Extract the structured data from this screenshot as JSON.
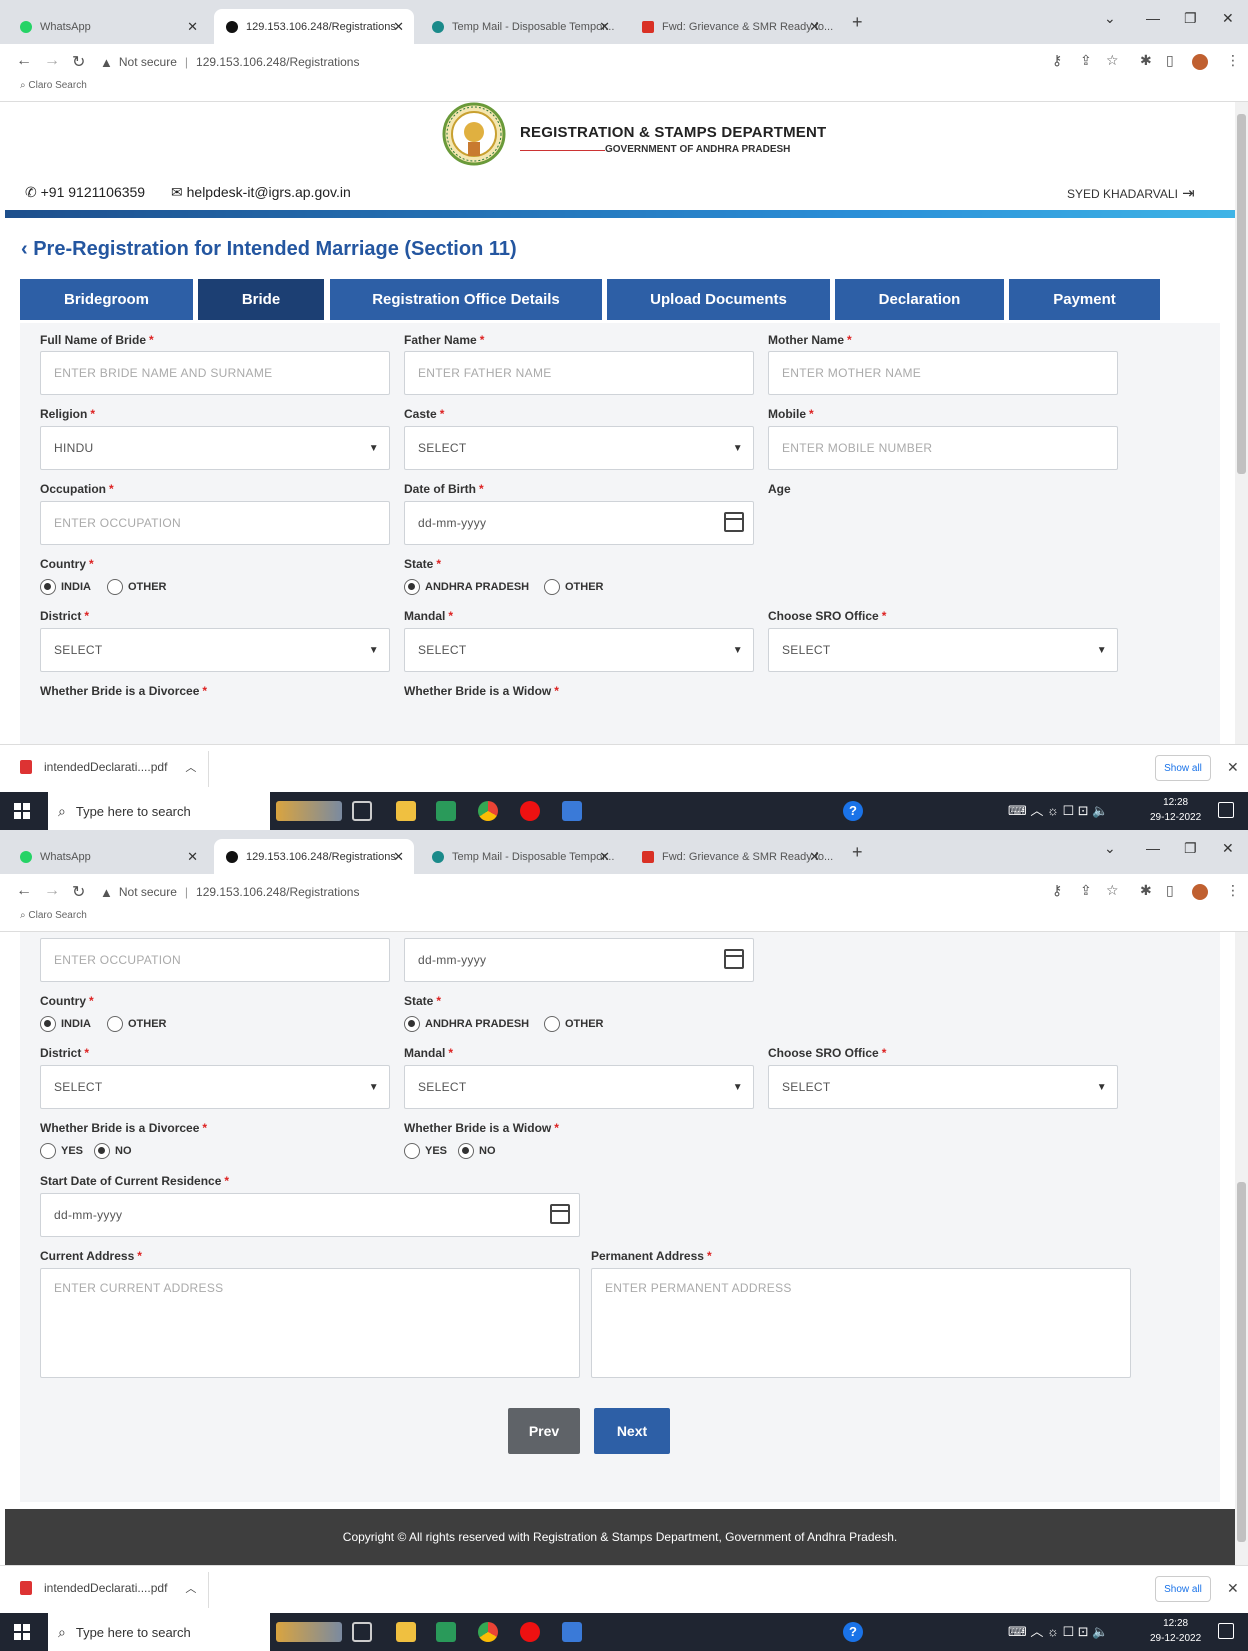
{
  "browser": {
    "tabs": [
      {
        "title": "WhatsApp",
        "active": false,
        "favicon_color": "#25d366"
      },
      {
        "title": "129.153.106.248/Registrations",
        "active": true,
        "favicon_color": "#111111"
      },
      {
        "title": "Temp Mail - Disposable Tempor...",
        "active": false,
        "favicon_color": "#1a8a8a"
      },
      {
        "title": "Fwd: Grievance & SMR Ready fo...",
        "active": false,
        "favicon_color": "#d93025"
      }
    ],
    "new_tab": "+",
    "not_secure": "Not secure",
    "url": "129.153.106.248/Registrations",
    "bookmark": "Claro Search"
  },
  "header": {
    "dept_title": "REGISTRATION & STAMPS DEPARTMENT",
    "dept_subtitle": "GOVERNMENT OF ANDHRA PRADESH",
    "phone": "+91 9121106359",
    "email": "helpdesk-it@igrs.ap.gov.in",
    "user": "SYED KHADARVALI"
  },
  "page_title": "Pre-Registration for Intended Marriage (Section 11)",
  "steps": [
    "Bridegroom",
    "Bride",
    "Registration Office Details",
    "Upload Documents",
    "Declaration",
    "Payment"
  ],
  "current_step": "Bride",
  "form": {
    "full_name": {
      "label": "Full Name of Bride",
      "placeholder": "ENTER BRIDE NAME AND SURNAME"
    },
    "father_name": {
      "label": "Father Name",
      "placeholder": "ENTER FATHER NAME"
    },
    "mother_name": {
      "label": "Mother Name",
      "placeholder": "ENTER MOTHER NAME"
    },
    "religion": {
      "label": "Religion",
      "value": "HINDU"
    },
    "caste": {
      "label": "Caste",
      "value": "SELECT"
    },
    "mobile": {
      "label": "Mobile",
      "placeholder": "ENTER MOBILE NUMBER"
    },
    "occupation": {
      "label": "Occupation",
      "placeholder": "ENTER OCCUPATION"
    },
    "dob": {
      "label": "Date of Birth",
      "placeholder": "dd-mm-yyyy"
    },
    "age": {
      "label": "Age"
    },
    "country": {
      "label": "Country",
      "options": [
        "INDIA",
        "OTHER"
      ],
      "selected": "INDIA"
    },
    "state": {
      "label": "State",
      "options": [
        "ANDHRA PRADESH",
        "OTHER"
      ],
      "selected": "ANDHRA PRADESH"
    },
    "district": {
      "label": "District",
      "value": "SELECT"
    },
    "mandal": {
      "label": "Mandal",
      "value": "SELECT"
    },
    "sro": {
      "label": "Choose SRO Office",
      "value": "SELECT"
    },
    "divorcee": {
      "label": "Whether Bride is a Divorcee",
      "options": [
        "YES",
        "NO"
      ],
      "selected": "NO"
    },
    "widow": {
      "label": "Whether Bride is a Widow",
      "options": [
        "YES",
        "NO"
      ],
      "selected": "NO"
    },
    "residence_start": {
      "label": "Start Date of Current Residence",
      "placeholder": "dd-mm-yyyy"
    },
    "current_address": {
      "label": "Current Address",
      "placeholder": "ENTER CURRENT ADDRESS"
    },
    "permanent_address": {
      "label": "Permanent Address",
      "placeholder": "ENTER PERMANENT ADDRESS"
    },
    "required_mark": "*"
  },
  "buttons": {
    "prev": "Prev",
    "next": "Next"
  },
  "footer": "Copyright © All rights reserved with Registration & Stamps Department, Government of Andhra Pradesh.",
  "downloads": {
    "file": "intendedDeclarati....pdf",
    "show_all": "Show all"
  },
  "taskbar": {
    "search_placeholder": "Type here to search",
    "time": "12:28",
    "date": "29-12-2022"
  },
  "colors": {
    "primary": "#2d5fa6",
    "active_step": "#1c3f73",
    "title": "#2456a0",
    "required": "#d22222"
  }
}
